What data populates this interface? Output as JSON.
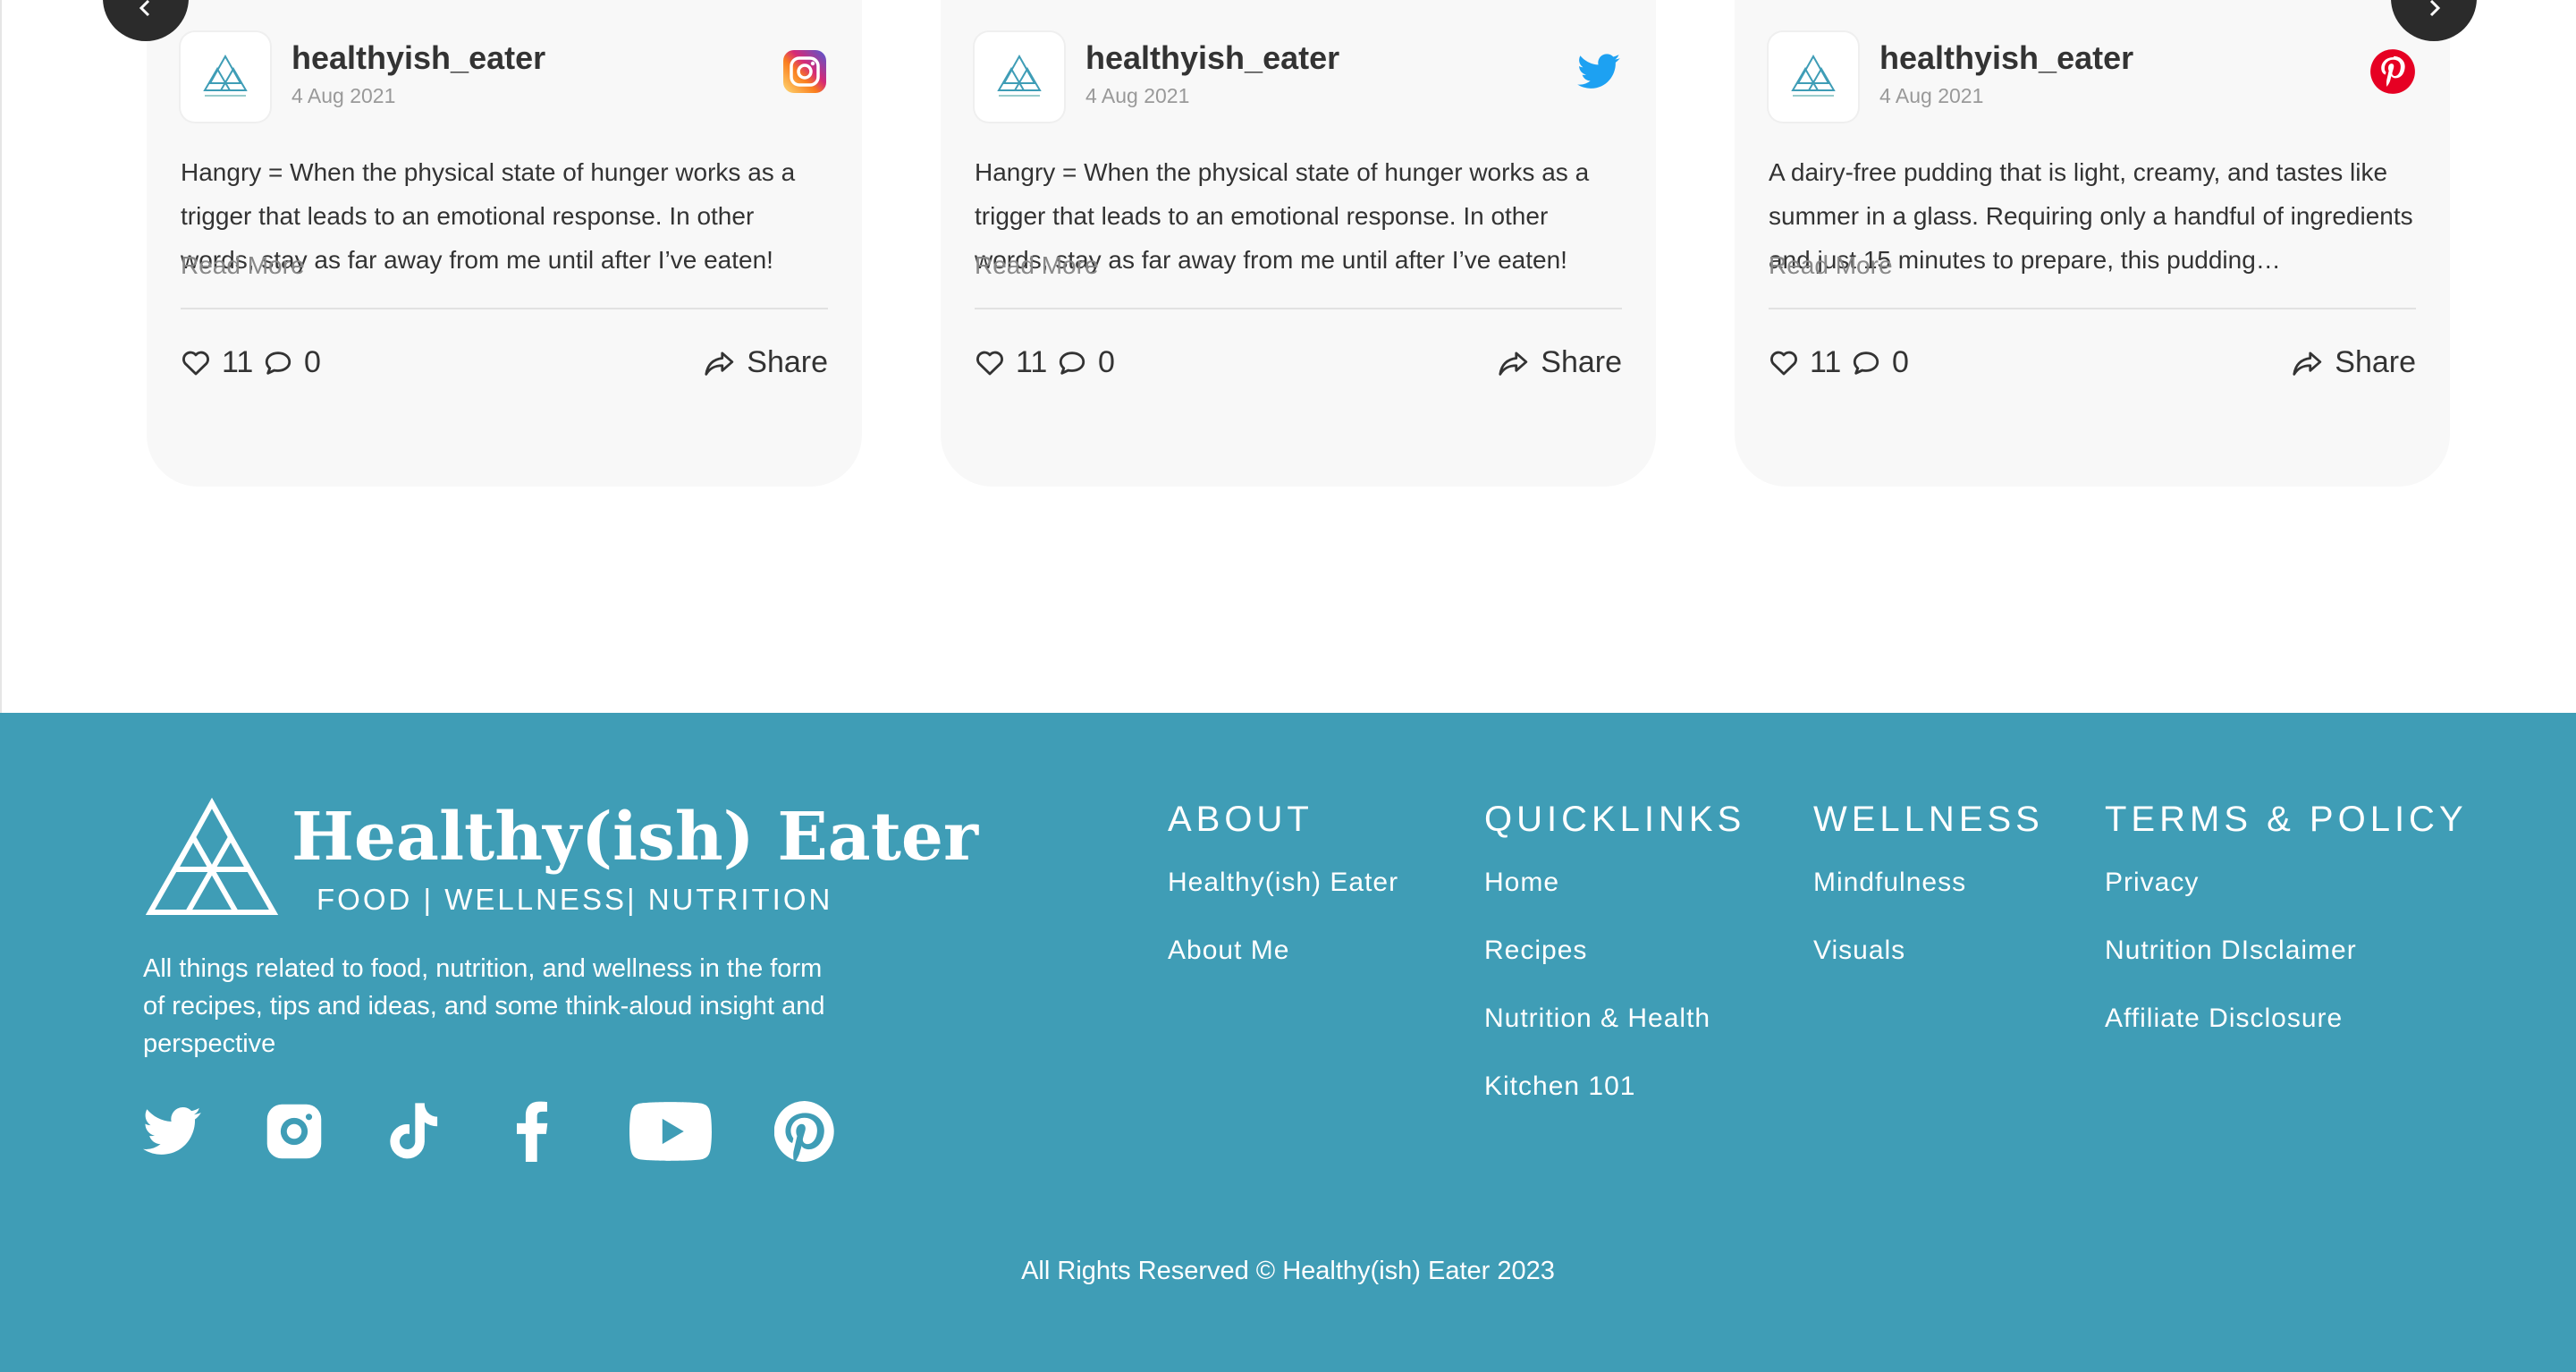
{
  "feed": {
    "cards": [
      {
        "handle": "healthyish_eater",
        "date": "4 Aug 2021",
        "network": "instagram",
        "text": "Hangry = When the physical state of hunger works as a trigger that leads to an emotional response. In other words, stay as far away from me until after I’ve eaten!",
        "read_more": "Read More",
        "likes": "11",
        "comments": "0",
        "share": "Share"
      },
      {
        "handle": "healthyish_eater",
        "date": "4 Aug 2021",
        "network": "twitter",
        "text": "Hangry = When the physical state of hunger works as a trigger that leads to an emotional response. In other words, stay as far away from me until after I’ve eaten!",
        "read_more": "Read More",
        "likes": "11",
        "comments": "0",
        "share": "Share"
      },
      {
        "handle": "healthyish_eater",
        "date": "4 Aug 2021",
        "network": "pinterest",
        "text": "A dairy-free pudding that is light, creamy, and tastes like summer in a glass. Requiring only a handful of ingredients and just 15 minutes to prepare, this pudding…",
        "read_more": "Read More",
        "likes": "11",
        "comments": "0",
        "share": "Share"
      }
    ],
    "prev_icon": "chevron-left-icon",
    "next_icon": "chevron-right-icon"
  },
  "footer": {
    "brand": {
      "name": "Healthy(ish) Eater",
      "tagline": "FOOD | WELLNESS| NUTRITION",
      "description": "All things related to food, nutrition, and wellness in the form of recipes, tips and ideas, and some think-aloud insight and perspective"
    },
    "socials": [
      "twitter-icon",
      "instagram-icon",
      "tiktok-icon",
      "facebook-icon",
      "youtube-icon",
      "pinterest-icon"
    ],
    "columns": [
      {
        "title": "ABOUT",
        "links": [
          "Healthy(ish) Eater",
          "About Me"
        ]
      },
      {
        "title": "QUICKLINKS",
        "links": [
          "Home",
          "Recipes",
          "Nutrition & Health",
          "Kitchen 101"
        ]
      },
      {
        "title": "WELLNESS",
        "links": [
          "Mindfulness",
          "Visuals"
        ]
      },
      {
        "title": "TERMS & POLICY",
        "links": [
          "Privacy",
          "Nutrition DIsclaimer",
          "Affiliate Disclosure"
        ]
      }
    ],
    "copyright": "All Rights Reserved © Healthy(ish) Eater 2023"
  },
  "colors": {
    "footer_bg": "#3f9db6",
    "card_bg": "#f8f8f8",
    "instagram": "#d6249f",
    "twitter": "#1da1f2",
    "pinterest": "#e60023"
  }
}
